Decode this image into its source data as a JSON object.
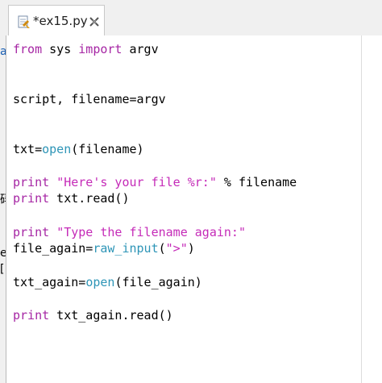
{
  "tab": {
    "title": "*ex15.py"
  },
  "left_fragments": [
    "a",
    "码",
    "e",
    "["
  ],
  "code": {
    "line1": {
      "kw_from": "from",
      "mod": " sys ",
      "kw_import": "import",
      "rest": " argv"
    },
    "line2": {
      "text": "script, filename=argv"
    },
    "line3": {
      "pre": "txt=",
      "fn": "open",
      "post": "(filename)"
    },
    "line4": {
      "kw": "print",
      "sp": " ",
      "str": "\"Here's your file %r:\"",
      "post": " % filename"
    },
    "line5": {
      "kw": "print",
      "post": " txt.read()"
    },
    "line6": {
      "kw": "print",
      "sp": " ",
      "str": "\"Type the filename again:\""
    },
    "line7": {
      "pre": "file_again=",
      "fn": "raw_input",
      "mid": "(",
      "str": "\">\"",
      "post": ")"
    },
    "line8": {
      "pre": "txt_again=",
      "fn": "open",
      "post": "(file_again)"
    },
    "line9": {
      "kw": "print",
      "post": " txt_again.read()"
    }
  },
  "colors": {
    "keyword": "#a626a4",
    "string": "#c52bb8",
    "builtin": "#2e95b7",
    "text": "#000000"
  },
  "icons": {
    "file": "python-file-icon",
    "close": "close-icon"
  }
}
